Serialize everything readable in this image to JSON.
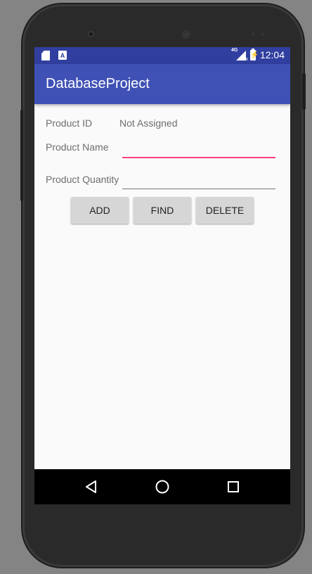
{
  "status_bar": {
    "network_type": "4G",
    "network_x": "x",
    "battery_symbol": "⚡",
    "time": "12:04"
  },
  "app_bar": {
    "title": "DatabaseProject"
  },
  "form": {
    "product_id_label": "Product ID",
    "product_id_value": "Not Assigned",
    "product_name_label": "Product Name",
    "product_name_value": "",
    "product_quantity_label": "Product Quantity",
    "product_quantity_value": ""
  },
  "buttons": {
    "add": "ADD",
    "find": "FIND",
    "delete": "DELETE"
  },
  "icons": {
    "status_left": [
      "sd-card-icon",
      "app-notification-icon"
    ],
    "nav": [
      "back-icon",
      "home-icon",
      "recents-icon"
    ]
  },
  "colors": {
    "primary": "#3f51b5",
    "primary_dark": "#303f9f",
    "accent": "#ff4081",
    "button": "#d6d6d6"
  }
}
